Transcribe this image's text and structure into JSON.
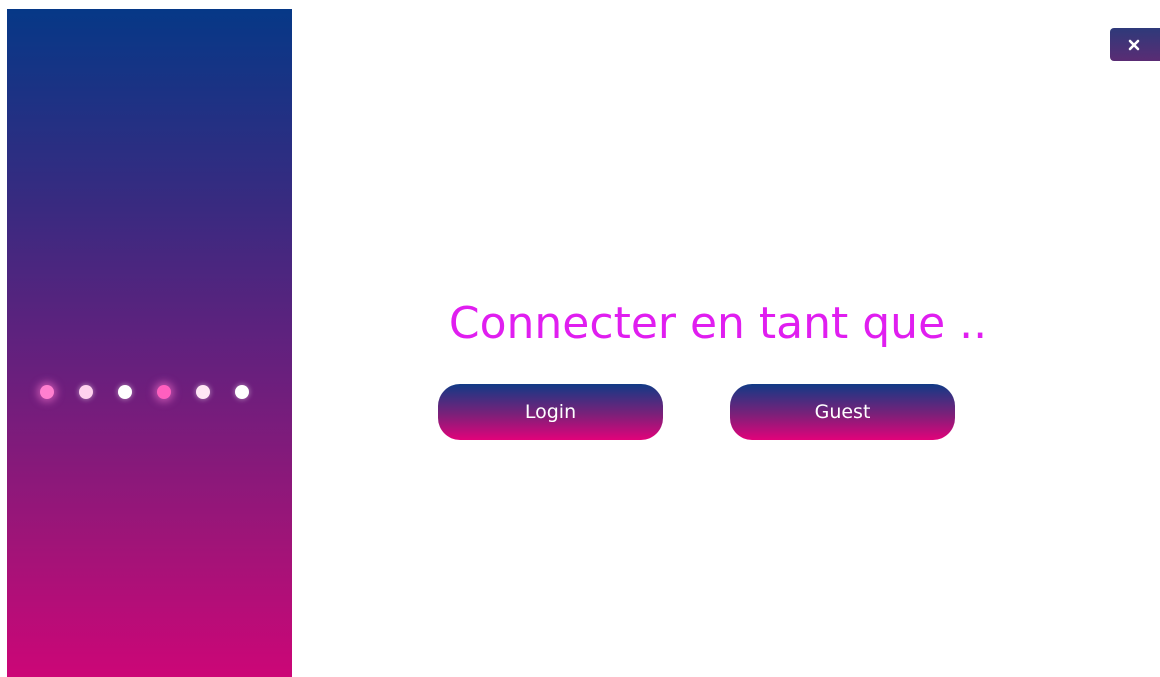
{
  "window": {
    "title": "",
    "close_icon": "close-icon"
  },
  "side_panel": {
    "gradient_top": "#063887",
    "gradient_bottom": "#cc0677",
    "dots": [
      {
        "color": "#ff7fcf",
        "glow": true
      },
      {
        "color": "#ffd1ee",
        "glow": false
      },
      {
        "color": "#ffffff",
        "glow": false
      },
      {
        "color": "#ff5fbf",
        "glow": true
      },
      {
        "color": "#ffe6f5",
        "glow": false
      },
      {
        "color": "#ffffff",
        "glow": false
      }
    ]
  },
  "main": {
    "title": "Connecter en tant que ..",
    "title_color": "#e01ef0",
    "buttons": {
      "login_label": "Login",
      "guest_label": "Guest"
    }
  }
}
